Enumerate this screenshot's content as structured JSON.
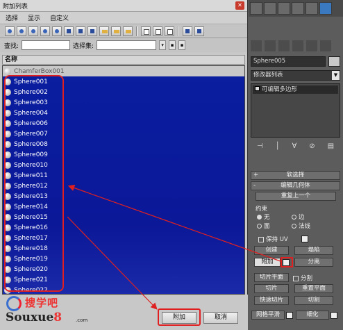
{
  "dialog": {
    "title": "附加列表",
    "close_glyph": "✕",
    "menu": [
      "选择",
      "显示",
      "自定义"
    ],
    "find_label": "查找:",
    "selset_label": "选择集:",
    "list_header": "名称",
    "items": [
      "ChamferBox001",
      "Sphere001",
      "Sphere002",
      "Sphere003",
      "Sphere004",
      "Sphere006",
      "Sphere007",
      "Sphere008",
      "Sphere009",
      "Sphere010",
      "Sphere011",
      "Sphere012",
      "Sphere013",
      "Sphere014",
      "Sphere015",
      "Sphere016",
      "Sphere017",
      "Sphere018",
      "Sphere019",
      "Sphere020",
      "Sphere021",
      "Sphere022"
    ],
    "ok_label": "附加",
    "cancel_label": "取消"
  },
  "watermark": {
    "cn": "搜学吧",
    "en_a": "Souxue",
    "en_b": "8",
    "domain": ".com"
  },
  "panel": {
    "object_name": "Sphere005",
    "modifier_list": "修改器列表",
    "stack_item": "可编辑多边形",
    "soft_select": "软选择",
    "edit_geometry": "编辑几何体",
    "repeat_last": "重复上一个",
    "constraints": "约束",
    "c_none": "无",
    "c_edge": "边",
    "c_face": "面",
    "c_normal": "法线",
    "preserve_uv": "保持 UV",
    "create": "创建",
    "collapse": "塌陷",
    "attach": "附加",
    "detach": "分离",
    "slice_plane": "切片平面",
    "split": "分割",
    "slice": "切片",
    "reset_plane": "重置平面",
    "quickslice": "快速切片",
    "cut": "切割",
    "meshsmooth": "网格平滑",
    "tessellate": "细化"
  },
  "colors": {
    "list_bg": "#0b1898",
    "highlight": "#e02020"
  }
}
